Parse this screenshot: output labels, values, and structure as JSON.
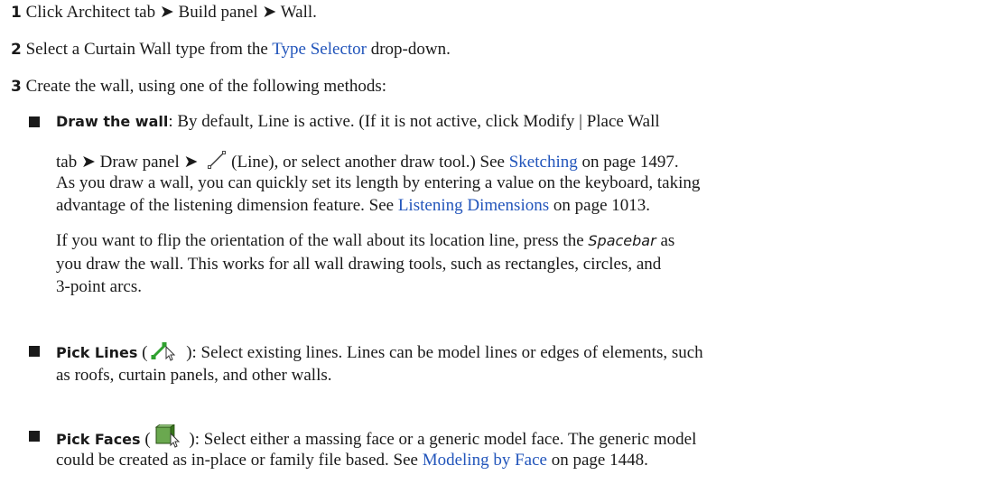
{
  "steps": {
    "s1": {
      "num": "1",
      "a": "Click Architect tab ➤ Build panel ➤ Wall."
    },
    "s2": {
      "num": "2",
      "a": "Select a Curtain Wall type from the ",
      "link": "Type Selector",
      "b": " drop-down."
    },
    "s3": {
      "num": "3",
      "a": "Create the wall, using one of the following methods:"
    }
  },
  "draw": {
    "term": "Draw the wall",
    "l1": ": By default, Line is active. (If it is not active, click Modify | Place Wall",
    "l2a": "tab ➤ Draw panel ➤ ",
    "l2b": "(Line), or select another draw tool.) See ",
    "l2link": "Sketching",
    "l2c": " on page 1497.",
    "l3": "As you draw a wall, you can quickly set its length by entering a value on the keyboard, taking",
    "l4a": "advantage of the listening dimension feature. See ",
    "l4link": "Listening Dimensions",
    "l4b": " on page 1013.",
    "f1a": "If you want to flip the orientation of the wall about its location line, press the ",
    "f1i": "Spacebar",
    "f1b": " as",
    "f2": "you draw the wall. This works for all wall drawing tools, such as rectangles, circles, and",
    "f3": "3-point arcs."
  },
  "picklines": {
    "term": "Pick Lines",
    "paren_open": " (",
    "l1": " ): Select existing lines. Lines can be model lines or edges of elements, such",
    "l2": "as roofs, curtain panels, and other walls."
  },
  "pickfaces": {
    "term": "Pick Faces",
    "paren_open": " (",
    "l1": " ): Select either a massing face or a generic model face. The generic model",
    "l2a": "could be created as in-place or family file based. See ",
    "l2link": "Modeling by Face",
    "l2b": " on page 1448."
  },
  "icons": {
    "draw_line": "line-tool-icon",
    "pick_lines": "pick-lines-icon",
    "pick_faces": "pick-faces-icon"
  },
  "colors": {
    "link": "#2255bb",
    "text": "#1a1a1a"
  }
}
